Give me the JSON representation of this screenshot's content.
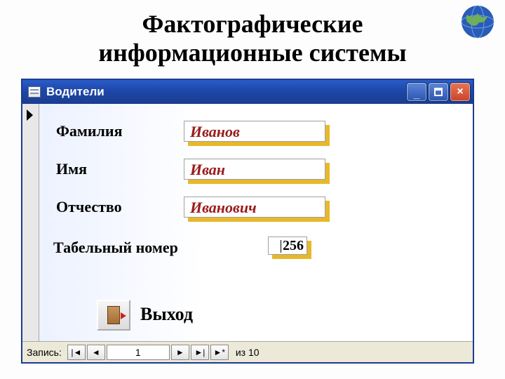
{
  "slide": {
    "title": "Фактографические информационные системы"
  },
  "window": {
    "title": "Водители",
    "captions": {
      "minimize": "_",
      "close": "×"
    }
  },
  "form": {
    "labels": {
      "surname": "Фамилия",
      "name": "Имя",
      "patronymic": "Отчество",
      "employee_no": "Табельный номер"
    },
    "values": {
      "surname": "Иванов",
      "name": "Иван",
      "patronymic": "Иванович",
      "employee_no": "256"
    },
    "exit_label": "Выход"
  },
  "nav": {
    "label": "Запись:",
    "first": "|◄",
    "prev": "◄",
    "current": "1",
    "next": "►",
    "last": "►|",
    "new": "►*",
    "count_prefix": "из",
    "count": "10"
  }
}
